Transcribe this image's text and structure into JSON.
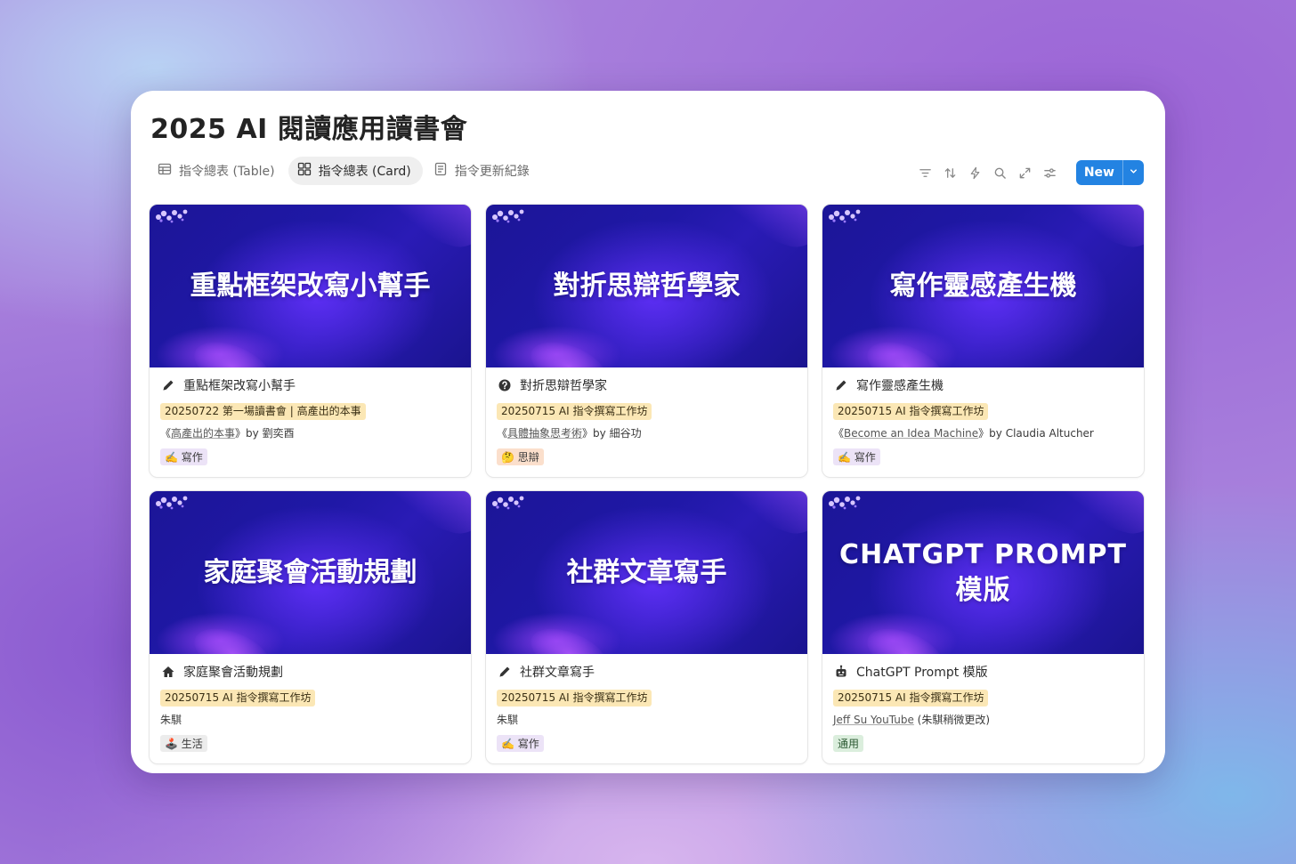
{
  "page": {
    "title": "2025 AI 閱讀應用讀書會"
  },
  "tabs": [
    {
      "label": "指令總表 (Table)",
      "icon": "table-icon",
      "active": false
    },
    {
      "label": "指令總表 (Card)",
      "icon": "gallery-icon",
      "active": true
    },
    {
      "label": "指令更新紀錄",
      "icon": "list-icon",
      "active": false
    }
  ],
  "toolbar": {
    "icons": [
      "filter-icon",
      "sort-icon",
      "automation-bolt-icon",
      "search-icon",
      "expand-icon",
      "settings-sliders-icon"
    ],
    "new_label": "New",
    "accent": "#2383e2"
  },
  "cards": [
    {
      "cover_text": "重點框架改寫小幫手",
      "icon": "pencil-icon",
      "title": "重點框架改寫小幫手",
      "tag": "20250722 第一場讀書會 | 高產出的本事",
      "source_prefix": "《",
      "source_link": "高產出的本事",
      "source_suffix": "》by 劉奕酉",
      "category": "✍️ 寫作",
      "category_color": "purple"
    },
    {
      "cover_text": "對折思辯哲學家",
      "icon": "question-circle-icon",
      "title": "對折思辯哲學家",
      "tag": "20250715 AI 指令撰寫工作坊",
      "source_prefix": "《",
      "source_link": "具體抽象思考術",
      "source_suffix": "》by 細谷功",
      "category": "🤔 思辯",
      "category_color": "orange"
    },
    {
      "cover_text": "寫作靈感產生機",
      "icon": "pencil-icon",
      "title": "寫作靈感產生機",
      "tag": "20250715 AI 指令撰寫工作坊",
      "source_prefix": "《",
      "source_link": "Become an Idea Machine",
      "source_suffix": "》by Claudia Altucher",
      "category": "✍️ 寫作",
      "category_color": "purple"
    },
    {
      "cover_text": "家庭聚會活動規劃",
      "icon": "home-icon",
      "title": "家庭聚會活動規劃",
      "tag": "20250715 AI 指令撰寫工作坊",
      "source_prefix": "朱騏",
      "source_link": "",
      "source_suffix": "",
      "category": "🕹️ 生活",
      "category_color": "grey"
    },
    {
      "cover_text": "社群文章寫手",
      "icon": "pencil-icon",
      "title": "社群文章寫手",
      "tag": "20250715 AI 指令撰寫工作坊",
      "source_prefix": "朱騏",
      "source_link": "",
      "source_suffix": "",
      "category": "✍️ 寫作",
      "category_color": "purple"
    },
    {
      "cover_text": "CHATGPT PROMPT 模版",
      "icon": "robot-icon",
      "title": "ChatGPT Prompt 模版",
      "tag": "20250715 AI 指令撰寫工作坊",
      "source_prefix": "",
      "source_link": "Jeff Su YouTube",
      "source_suffix": " (朱騏稍微更改)",
      "category": "通用",
      "category_color": "green"
    }
  ]
}
